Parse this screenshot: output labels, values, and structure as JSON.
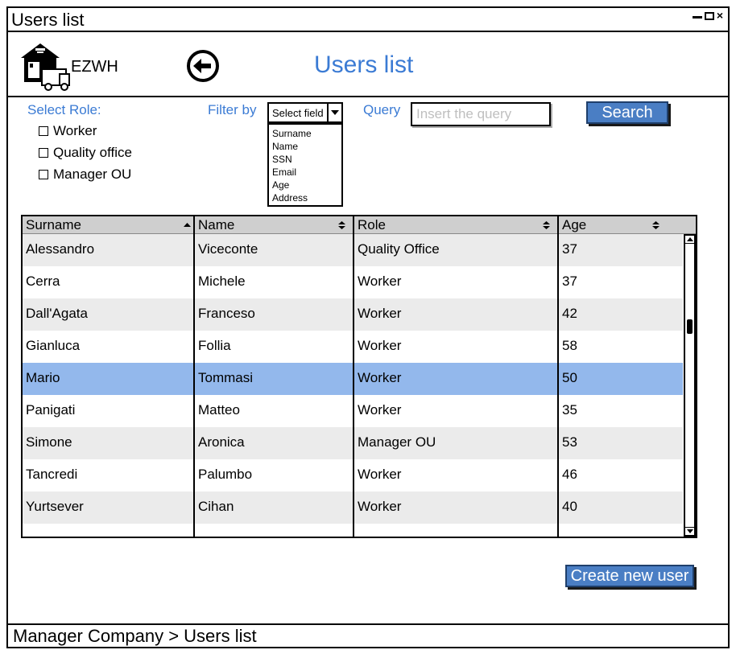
{
  "window": {
    "title": "Users list"
  },
  "header": {
    "brand": "EZWH",
    "page_title": "Users list"
  },
  "filters": {
    "select_role_label": "Select Role:",
    "roles": [
      "Worker",
      "Quality office",
      "Manager OU"
    ],
    "filter_by_label": "Filter by",
    "select_field": "Select field",
    "field_options": [
      "Surname",
      "Name",
      "SSN",
      "Email",
      "Age",
      "Address"
    ],
    "query_label": "Query",
    "query_placeholder": "Insert the query",
    "search_label": "Search"
  },
  "table": {
    "columns": [
      "Surname",
      "Name",
      "Role",
      "Age"
    ],
    "rows": [
      [
        "Alessandro",
        "Viceconte",
        "Quality Office",
        "37"
      ],
      [
        "Cerra",
        "Michele",
        "Worker",
        "37"
      ],
      [
        "Dall'Agata",
        "Franceso",
        "Worker",
        "42"
      ],
      [
        "Gianluca",
        "Follia",
        "Worker",
        "58"
      ],
      [
        "Mario",
        "Tommasi",
        "Worker",
        "50"
      ],
      [
        "Panigati",
        "Matteo",
        "Worker",
        "35"
      ],
      [
        "Simone",
        "Aronica",
        "Manager OU",
        "53"
      ],
      [
        "Tancredi",
        "Palumbo",
        "Worker",
        "46"
      ],
      [
        "Yurtsever",
        "Cihan",
        "Worker",
        "40"
      ]
    ],
    "selected_row": 4
  },
  "actions": {
    "create_label": "Create new user"
  },
  "footer": {
    "breadcrumb": "Manager Company > Users list"
  },
  "colors": {
    "accent": "#3b7bd4",
    "button": "#4a7ec4",
    "selected_row": "#93b8ec",
    "alt_row": "#ebebeb",
    "header_bg": "#cfcfcf"
  }
}
